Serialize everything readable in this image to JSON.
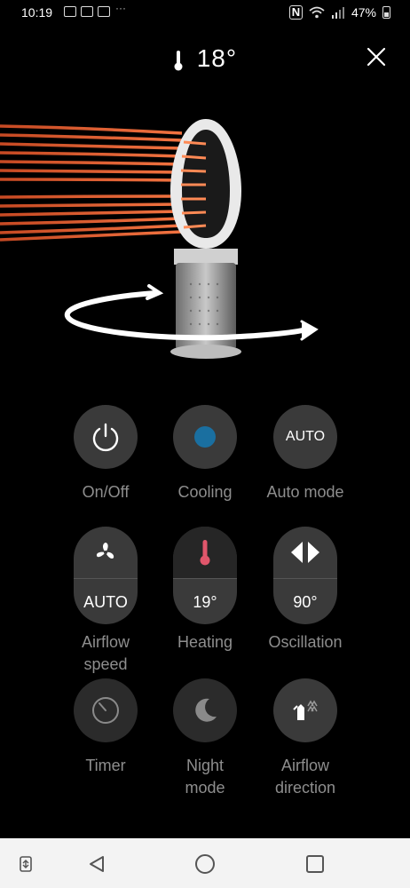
{
  "status_bar": {
    "time": "10:19",
    "overflow": "···",
    "nfc": "N",
    "battery": "47%"
  },
  "header": {
    "temperature": "18°"
  },
  "controls": [
    {
      "id": "onoff",
      "label": "On/Off",
      "icon": "power-icon"
    },
    {
      "id": "cooling",
      "label": "Cooling",
      "icon": "cooling-dot-icon",
      "accent": "#1a6fa0"
    },
    {
      "id": "auto",
      "label": "Auto mode",
      "value": "AUTO"
    },
    {
      "id": "airflow_speed",
      "label": "Airflow speed",
      "label_lines": [
        "Airflow",
        "speed"
      ],
      "icon": "fan-icon",
      "value": "AUTO"
    },
    {
      "id": "heating",
      "label": "Heating",
      "icon": "thermometer-icon",
      "value": "19°",
      "accent": "#e0566b"
    },
    {
      "id": "oscillation",
      "label": "Oscillation",
      "icon": "oscillation-icon",
      "value": "90°"
    },
    {
      "id": "timer",
      "label": "Timer",
      "icon": "timer-icon"
    },
    {
      "id": "night",
      "label": "Night mode",
      "label_lines": [
        "Night",
        "mode"
      ],
      "icon": "moon-icon"
    },
    {
      "id": "airflow_direction",
      "label": "Airflow direction",
      "label_lines": [
        "Airflow",
        "direction"
      ],
      "icon": "airflow-direction-icon"
    }
  ],
  "colors": {
    "background": "#000000",
    "button": "#3a3a3a",
    "label": "#8e8e8e",
    "heat_stream": "#e8572a"
  }
}
